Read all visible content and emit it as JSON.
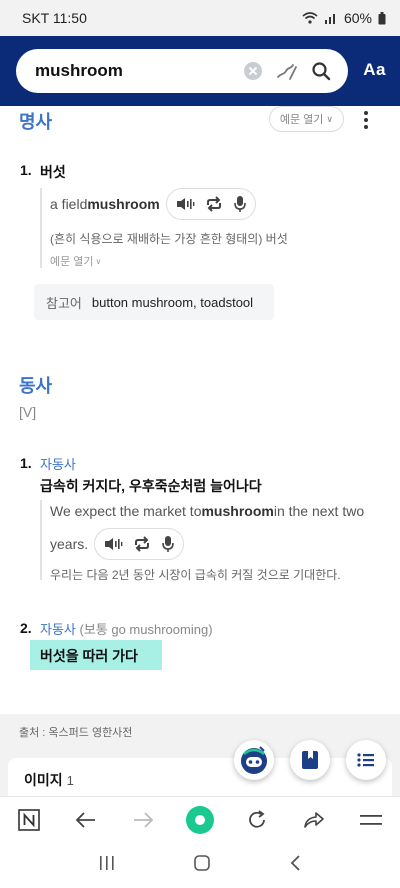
{
  "status": {
    "carrier_time": "SKT 11:50",
    "battery": "60%"
  },
  "search": {
    "query": "mushroom",
    "font_button": "Aa"
  },
  "noun": {
    "pos": "명사",
    "example_toggle": "예문 열기",
    "senses": [
      {
        "num": "1.",
        "definition": "버섯",
        "example_pre": "a field ",
        "example_bold": "mushroom",
        "translation": "(흔히 식용으로 재배하는 가장 흔한 형태의) 버섯",
        "more_examples": "예문 열기"
      }
    ],
    "reference": {
      "label": "참고어",
      "text": "button mushroom, toadstool"
    }
  },
  "verb": {
    "pos": "동사",
    "bracket": "[V]",
    "senses": [
      {
        "num": "1.",
        "gram": "자동사",
        "definition": "급속히 커지다, 우후죽순처럼 늘어나다",
        "example_pre": "We expect the market to ",
        "example_bold": "mushroom",
        "example_post": " in the next two",
        "example_line2": "years.",
        "translation": "우리는 다음 2년 동안 시장이 급속히 커질 것으로 기대한다."
      },
      {
        "num": "2.",
        "gram": "자동사",
        "note": " (보통 go mushrooming)",
        "definition": "버섯을 따러 가다"
      }
    ]
  },
  "source": "출처 : 옥스퍼드 영한사전",
  "image_section": {
    "title": "이미지",
    "count": "1"
  },
  "colors": {
    "header": "#0b2a78",
    "accent_blue": "#3c74c8",
    "highlight": "#a8f0e6",
    "green_button": "#19c98f"
  }
}
